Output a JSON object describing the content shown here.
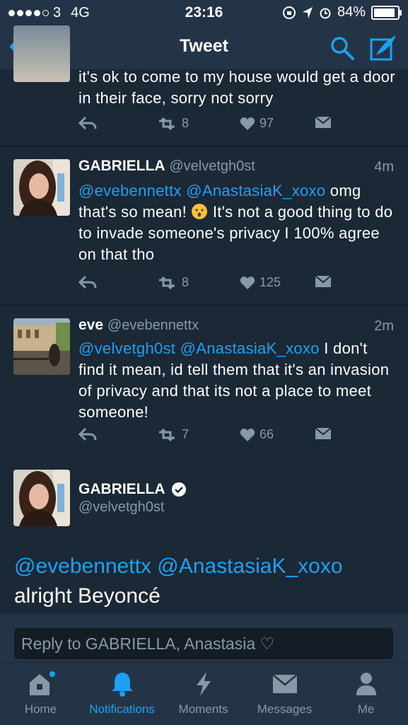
{
  "status_bar": {
    "carrier": "3",
    "network": "4G",
    "time": "23:16",
    "battery": "84%"
  },
  "nav": {
    "title": "Tweet"
  },
  "tweets": [
    {
      "text": "it's ok to come to my house would get a door in their face, sorry not sorry",
      "retweets": "8",
      "likes": "97"
    },
    {
      "name": "GABRIELLA",
      "handle": "@velvetgh0st",
      "time": "4m",
      "mention1": "@evebennettx",
      "mention2": "@AnastasiaK_xoxo",
      "text_a": " omg that's so mean! ",
      "text_b": " It's not a good thing to do to invade someone's privacy I 100% agree on that tho",
      "retweets": "8",
      "likes": "125"
    },
    {
      "name": "eve",
      "handle": "@evebennettx",
      "time": "2m",
      "mention1": "@velvetgh0st",
      "mention2": "@AnastasiaK_xoxo",
      "text": " I don't find it mean, id tell them that it's an invasion of privacy and that its not a place to meet someone!",
      "retweets": "7",
      "likes": "66"
    }
  ],
  "detail": {
    "name": "GABRIELLA",
    "handle": "@velvetgh0st",
    "mention1": "@evebennettx",
    "mention2": "@AnastasiaK_xoxo",
    "text": "alright Beyoncé"
  },
  "reply": {
    "placeholder": "Reply to GABRIELLA, Anastasia ♡"
  },
  "tabs": [
    {
      "label": "Home",
      "icon": "home-icon"
    },
    {
      "label": "Notifications",
      "icon": "bell-icon",
      "active": true
    },
    {
      "label": "Moments",
      "icon": "lightning-icon"
    },
    {
      "label": "Messages",
      "icon": "envelope-icon"
    },
    {
      "label": "Me",
      "icon": "person-icon"
    }
  ],
  "colors": {
    "accent": "#1da1f2",
    "background": "#141d26",
    "card": "#1b2836",
    "bar": "#243447",
    "muted": "#8899a6"
  }
}
